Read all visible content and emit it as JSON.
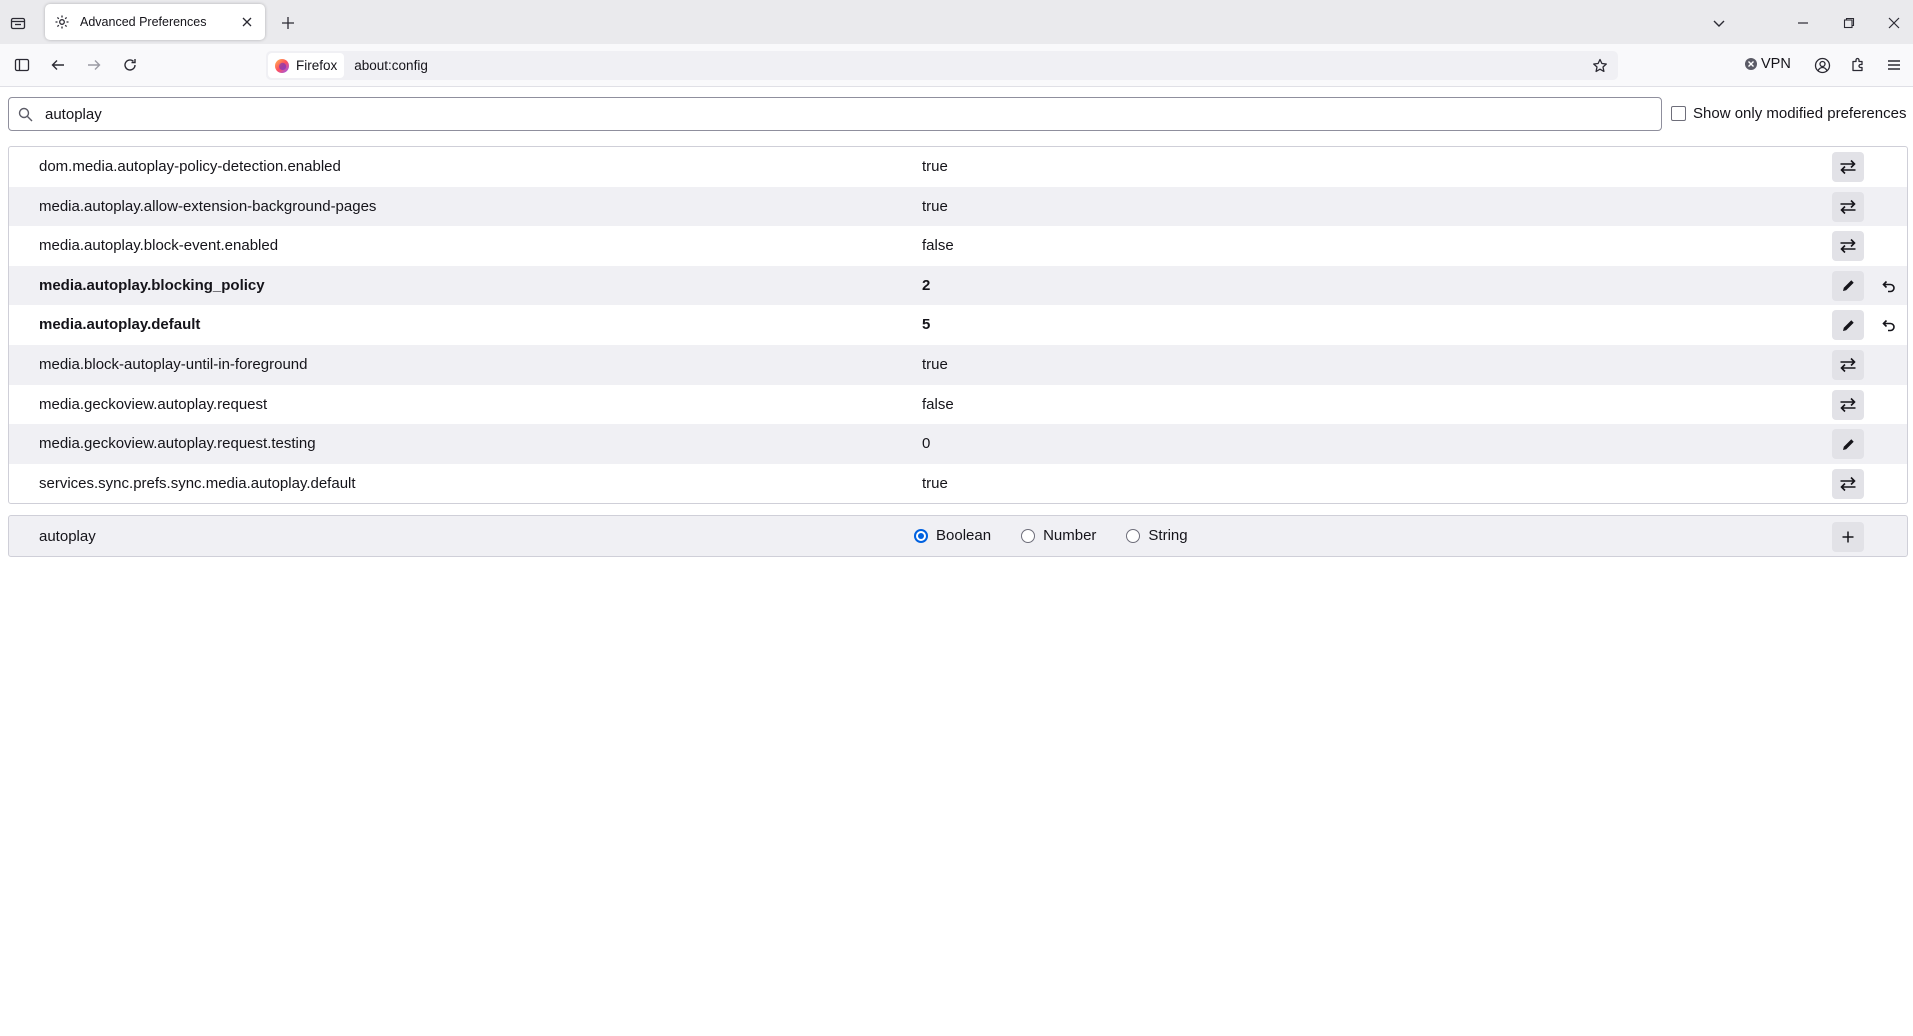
{
  "tab": {
    "title": "Advanced Preferences"
  },
  "url": {
    "identity_label": "Firefox",
    "address": "about:config"
  },
  "toolbar": {
    "vpn_label": "VPN"
  },
  "search": {
    "value": "autoplay"
  },
  "filter": {
    "show_modified_label": "Show only modified preferences",
    "checked": false
  },
  "prefs": [
    {
      "name": "dom.media.autoplay-policy-detection.enabled",
      "value": "true",
      "action": "toggle",
      "modified": false
    },
    {
      "name": "media.autoplay.allow-extension-background-pages",
      "value": "true",
      "action": "toggle",
      "modified": false
    },
    {
      "name": "media.autoplay.block-event.enabled",
      "value": "false",
      "action": "toggle",
      "modified": false
    },
    {
      "name": "media.autoplay.blocking_policy",
      "value": "2",
      "action": "edit",
      "modified": true
    },
    {
      "name": "media.autoplay.default",
      "value": "5",
      "action": "edit",
      "modified": true
    },
    {
      "name": "media.block-autoplay-until-in-foreground",
      "value": "true",
      "action": "toggle",
      "modified": false
    },
    {
      "name": "media.geckoview.autoplay.request",
      "value": "false",
      "action": "toggle",
      "modified": false
    },
    {
      "name": "media.geckoview.autoplay.request.testing",
      "value": "0",
      "action": "edit",
      "modified": false
    },
    {
      "name": "services.sync.prefs.sync.media.autoplay.default",
      "value": "true",
      "action": "toggle",
      "modified": false
    }
  ],
  "new_pref": {
    "name": "autoplay",
    "types": [
      {
        "label": "Boolean",
        "checked": true
      },
      {
        "label": "Number",
        "checked": false
      },
      {
        "label": "String",
        "checked": false
      }
    ]
  },
  "colors": {
    "accent": "#0061e0",
    "alt_row": "#f0f0f4",
    "button_bg": "#e2e2e7"
  },
  "icons": [
    "firefox-view-icon",
    "gear-icon",
    "close-icon",
    "plus-icon",
    "chevron-down-icon",
    "minimize-icon",
    "restore-icon",
    "sidebar-icon",
    "back-icon",
    "forward-icon",
    "reload-icon",
    "firefox-logo-icon",
    "star-icon",
    "vpn-icon",
    "account-icon",
    "extensions-icon",
    "menu-icon",
    "search-icon",
    "toggle-icon",
    "edit-icon",
    "reset-icon"
  ]
}
